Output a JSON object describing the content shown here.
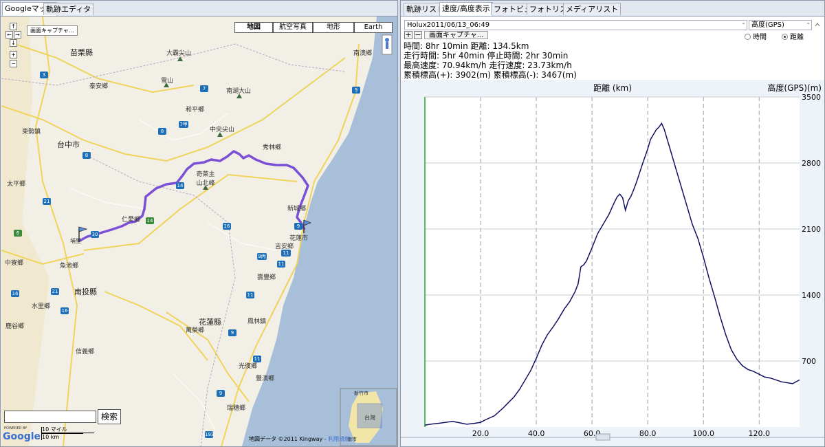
{
  "left_tabs": [
    "Googleマップ",
    "軌跡エディタ"
  ],
  "right_tabs": [
    "軌跡リスト",
    "速度/高度表示",
    "フォトビュー",
    "フォトリスト",
    "メディアリスト"
  ],
  "map": {
    "capture_button": "画面キャプチャ...",
    "map_types": [
      "地図",
      "航空写真",
      "地形",
      "Earth"
    ],
    "search_button": "検索",
    "scale_miles": "10 マイル",
    "scale_km": "10 km",
    "powered_by": "POWERED BY",
    "google_logo": "Google",
    "attribution": "地図データ ©2011 Kingway - ",
    "terms_link": "利用規約",
    "labels": {
      "miaoli": "苗栗縣",
      "taian": "泰安鄉",
      "dabajian": "大霸尖山",
      "xueshan": "雪山",
      "nanhu": "南湖大山",
      "nanao": "南澳鄉",
      "hepingxiang": "和平鄉",
      "dongshi": "東勢鎮",
      "taichung": "台中市",
      "zhongyang": "中央尖山",
      "xiulin": "秀林鄉",
      "qilai": "奇萊主山北峰",
      "taiping": "太平鄉",
      "renai": "仁愛鄉",
      "xincheng": "新城鄉",
      "hualien": "花蓮市",
      "jian": "吉安鄉",
      "zhongliao": "中寮鄉",
      "yuchi": "魚池鄉",
      "nantou": "南投縣",
      "shoufeng": "壽豐鄉",
      "shuili": "水里鄉",
      "hualiencounty": "花蓮縣",
      "fenglin": "鳳林鎮",
      "wanrong": "萬榮鄉",
      "luku": "鹿谷鄉",
      "xinyi": "信義鄉",
      "guangfu": "光復鄉",
      "fengbin": "豐濱鄉",
      "ruisui": "瑞穗鄉",
      "puli": "埔里",
      "xinzhu": "新竹市",
      "taiwan": "台灣",
      "tainan": "南市"
    },
    "shields": [
      "3",
      "7",
      "8",
      "9",
      "7甲",
      "8",
      "14",
      "21",
      "6",
      "9",
      "11",
      "11甲",
      "9丙",
      "21",
      "16",
      "14",
      "16",
      "16",
      "11",
      "9",
      "9",
      "11",
      "30",
      "193"
    ]
  },
  "panel": {
    "track_name": "Holux2011/06/13_06:49",
    "y_select": "高度(GPS)",
    "plus_button": "+",
    "minus_button": "−",
    "capture_button": "画面キャプチャ...",
    "radio_time": "時間",
    "radio_distance": "距離",
    "stats": [
      "時間: 8hr 10min 距離: 134.5km",
      "走行時間: 5hr 40min 停止時間: 2hr 30min",
      "最高速度: 70.94km/h 走行速度: 23.73km/h",
      "累積標高(+): 3902(m) 累積標高(-): 3467(m)"
    ]
  },
  "chart_data": {
    "type": "line",
    "xlabel": "距離 (km)",
    "ylabel": "高度(GPS)(m)",
    "xlim": [
      0,
      134.5
    ],
    "ylim": [
      0,
      3500
    ],
    "x_ticks": [
      20.0,
      40.0,
      60.0,
      80.0,
      100.0,
      120.0
    ],
    "x_tick_labels": [
      "20.0",
      "40.0",
      "60.0",
      "80.0",
      "100.0",
      "120.0"
    ],
    "y_ticks": [
      700,
      1400,
      2100,
      2800,
      3500
    ],
    "y_tick_labels": [
      "700",
      "1400",
      "2100",
      "2800",
      "3500"
    ],
    "grid": true,
    "line_color": "#101060",
    "series": [
      {
        "x": [
          0,
          2,
          5,
          10,
          15,
          18,
          20,
          22,
          25,
          28,
          30,
          32,
          34,
          36,
          38,
          40,
          42,
          44,
          46,
          48,
          50,
          52,
          54,
          55,
          56,
          57,
          58,
          60,
          62,
          64,
          66,
          68,
          69,
          70,
          71,
          72,
          73,
          74,
          75,
          76,
          78,
          80,
          81,
          82,
          83,
          84,
          85,
          86,
          87,
          88,
          90,
          92,
          94,
          96,
          98,
          100,
          102,
          104,
          106,
          108,
          110,
          112,
          114,
          116,
          118,
          120,
          122,
          124,
          126,
          128,
          130,
          132,
          134.5
        ],
        "values": [
          20,
          30,
          40,
          60,
          30,
          40,
          50,
          80,
          120,
          200,
          260,
          320,
          400,
          500,
          600,
          730,
          870,
          980,
          1060,
          1150,
          1250,
          1330,
          1440,
          1520,
          1700,
          1720,
          1760,
          1900,
          2050,
          2150,
          2250,
          2380,
          2440,
          2470,
          2430,
          2300,
          2400,
          2450,
          2520,
          2600,
          2780,
          2950,
          3050,
          3100,
          3150,
          3180,
          3220,
          3150,
          3050,
          2950,
          2750,
          2550,
          2350,
          2150,
          2000,
          1800,
          1580,
          1380,
          1170,
          980,
          820,
          720,
          650,
          610,
          590,
          560,
          530,
          520,
          500,
          480,
          470,
          460,
          500
        ]
      }
    ]
  }
}
